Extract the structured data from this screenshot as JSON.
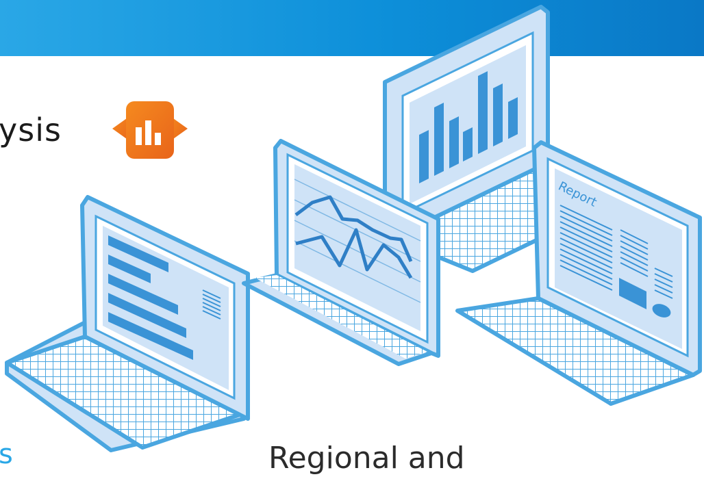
{
  "header": {
    "title_fragment": "ysis"
  },
  "laptops": {
    "report_label": "Report"
  },
  "footer": {
    "left_fragment": "s",
    "center_fragment": "Regional and"
  },
  "colors": {
    "banner_start": "#2aa7e6",
    "banner_end": "#0a78c6",
    "laptop_outline": "#4aa6e0",
    "screen_fill": "#cfe3f7",
    "accent_blue": "#3a93d6",
    "logo_orange": "#f07a1a"
  }
}
